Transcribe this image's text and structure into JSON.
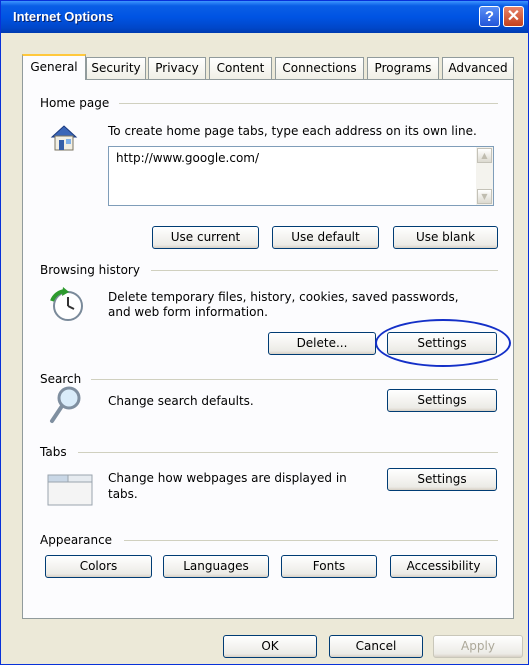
{
  "window": {
    "title": "Internet Options",
    "help_glyph": "?",
    "close_glyph": "✕"
  },
  "tabs": [
    "General",
    "Security",
    "Privacy",
    "Content",
    "Connections",
    "Programs",
    "Advanced"
  ],
  "home_page": {
    "group_label": "Home page",
    "description": "To create home page tabs, type each address on its own line.",
    "url_value": "http://www.google.com/",
    "use_current": "Use current",
    "use_default": "Use default",
    "use_blank": "Use blank"
  },
  "browsing_history": {
    "group_label": "Browsing history",
    "description_line1": "Delete temporary files, history, cookies, saved passwords,",
    "description_line2": "and web form information.",
    "delete_button": "Delete...",
    "settings_button": "Settings"
  },
  "search": {
    "group_label": "Search",
    "description": "Change search defaults.",
    "settings_button": "Settings"
  },
  "tabs_section": {
    "group_label": "Tabs",
    "description_line1": "Change how webpages are displayed in",
    "description_line2": "tabs.",
    "settings_button": "Settings"
  },
  "appearance": {
    "group_label": "Appearance",
    "colors": "Colors",
    "languages": "Languages",
    "fonts": "Fonts",
    "accessibility": "Accessibility"
  },
  "footer": {
    "ok": "OK",
    "cancel": "Cancel",
    "apply": "Apply"
  },
  "colors": {
    "title_bar": "#0054e3",
    "highlight_oval": "#1430c8",
    "tab_accent": "#ffc83c"
  }
}
